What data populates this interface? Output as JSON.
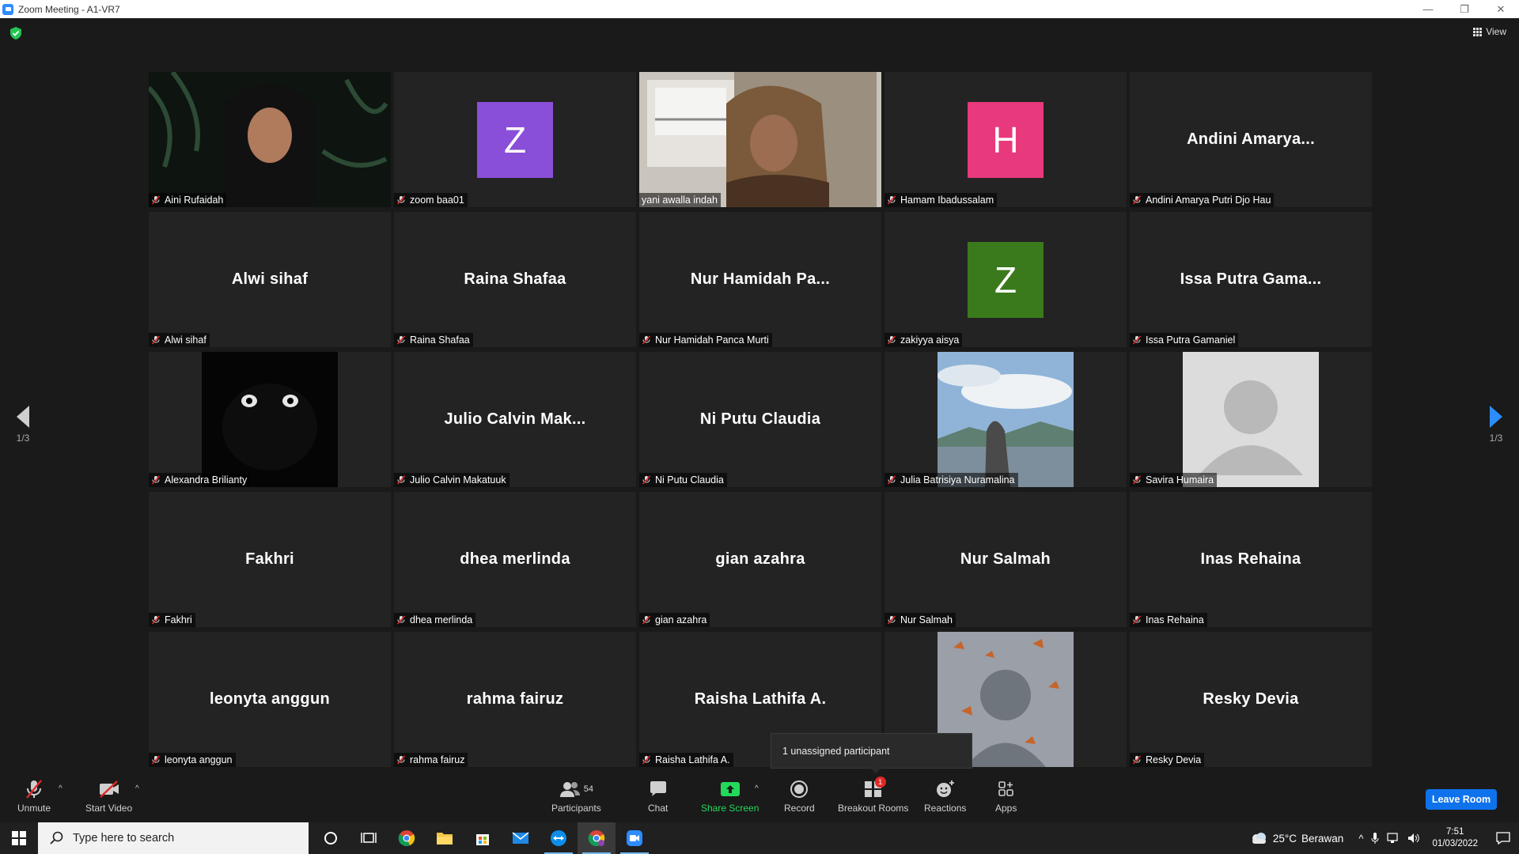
{
  "window": {
    "title": "Zoom Meeting - A1-VR7",
    "minimize": "—",
    "restore": "❐",
    "close": "✕"
  },
  "meeting": {
    "view_label": "View",
    "page_indicator_left": "1/3",
    "page_indicator_right": "1/3",
    "tooltip": "1 unassigned participant"
  },
  "participants": [
    {
      "big": "",
      "label": "Aini Rufaidah",
      "kind": "photo-dark"
    },
    {
      "big": "Z",
      "label": "zoom baa01",
      "kind": "avatar",
      "avatar_color": "#8a4fd8"
    },
    {
      "big": "",
      "label": "yani awalla indah",
      "kind": "photo-room"
    },
    {
      "big": "H",
      "label": "Hamam Ibadussalam",
      "kind": "avatar",
      "avatar_color": "#e8397d"
    },
    {
      "big": "Andini  Amarya...",
      "label": "Andini Amarya Putri Djo Hau",
      "kind": "name"
    },
    {
      "big": "Alwi sihaf",
      "label": "Alwi sihaf",
      "kind": "name"
    },
    {
      "big": "Raina Shafaa",
      "label": "Raina Shafaa",
      "kind": "name"
    },
    {
      "big": "Nur  Hamidah  Pa...",
      "label": "Nur Hamidah Panca Murti",
      "kind": "name"
    },
    {
      "big": "Z",
      "label": "zakiyya aisya",
      "kind": "avatar",
      "avatar_color": "#3a7a1c"
    },
    {
      "big": "Issa Putra Gama...",
      "label": "Issa Putra Gamaniel",
      "kind": "name"
    },
    {
      "big": "",
      "label": "Alexandra Brilianty",
      "kind": "photo-cat"
    },
    {
      "big": "Julio  Calvin  Mak...",
      "label": "Julio Calvin Makatuuk",
      "kind": "name"
    },
    {
      "big": "Ni Putu Claudia",
      "label": "Ni Putu Claudia",
      "kind": "name"
    },
    {
      "big": "",
      "label": "Julia Batrisiya Nuramalina",
      "kind": "photo-sky"
    },
    {
      "big": "",
      "label": "Savira Humaira",
      "kind": "photo-default"
    },
    {
      "big": "Fakhri",
      "label": "Fakhri",
      "kind": "name"
    },
    {
      "big": "dhea merlinda",
      "label": "dhea merlinda",
      "kind": "name"
    },
    {
      "big": "gian azahra",
      "label": "gian azahra",
      "kind": "name"
    },
    {
      "big": "Nur Salmah",
      "label": "Nur Salmah",
      "kind": "name"
    },
    {
      "big": "Inas Rehaina",
      "label": "Inas Rehaina",
      "kind": "name"
    },
    {
      "big": "leonyta anggun",
      "label": "leonyta anggun",
      "kind": "name"
    },
    {
      "big": "rahma fairuz",
      "label": "rahma fairuz",
      "kind": "name"
    },
    {
      "big": "Raisha Lathifa A.",
      "label": "Raisha Lathifa A.",
      "kind": "name"
    },
    {
      "big": "",
      "label": "",
      "kind": "photo-butterfly"
    },
    {
      "big": "Resky Devia",
      "label": "Resky Devia",
      "kind": "name"
    }
  ],
  "toolbar": {
    "unmute": "Unmute",
    "start_video": "Start Video",
    "participants": "Participants",
    "participants_count": "54",
    "chat": "Chat",
    "share_screen": "Share Screen",
    "record": "Record",
    "breakout_rooms": "Breakout Rooms",
    "breakout_badge": "1",
    "reactions": "Reactions",
    "apps": "Apps",
    "leave": "Leave Room",
    "caret": "^"
  },
  "taskbar": {
    "search_placeholder": "Type here to search",
    "temperature": "25°C",
    "weather": "Berawan",
    "time": "7:51",
    "date": "01/03/2022",
    "tray_up": "^"
  },
  "colors": {
    "accent_blue": "#2d8cff",
    "share_green": "#23d959",
    "active_speaker": "#e0e88b",
    "muted_red": "#e02828"
  }
}
